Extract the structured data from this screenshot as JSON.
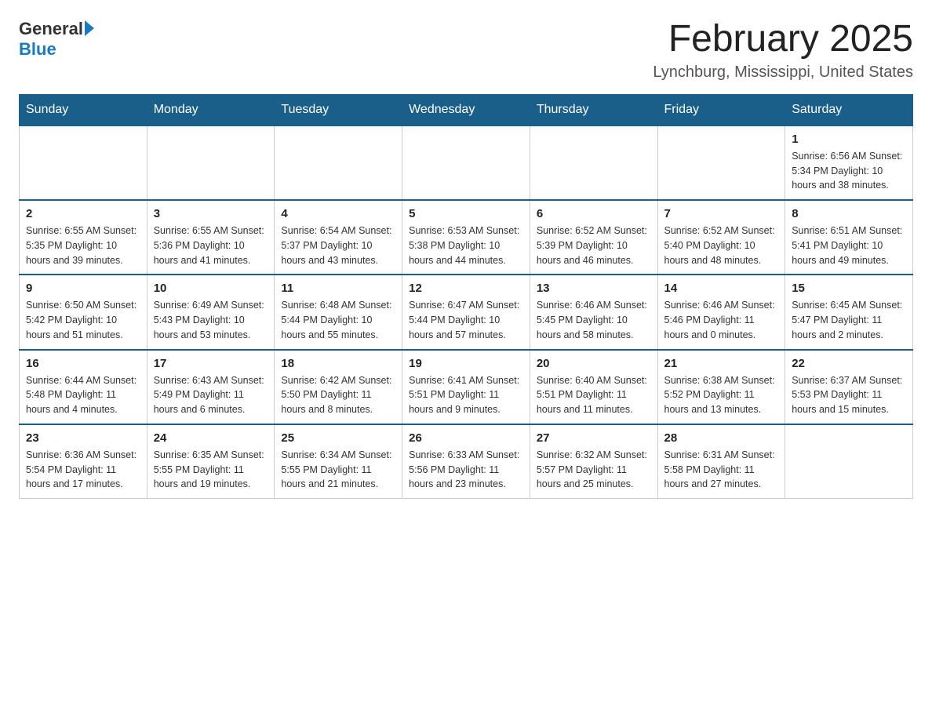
{
  "logo": {
    "general": "General",
    "blue": "Blue"
  },
  "title": "February 2025",
  "subtitle": "Lynchburg, Mississippi, United States",
  "weekdays": [
    "Sunday",
    "Monday",
    "Tuesday",
    "Wednesday",
    "Thursday",
    "Friday",
    "Saturday"
  ],
  "weeks": [
    [
      {
        "day": "",
        "info": ""
      },
      {
        "day": "",
        "info": ""
      },
      {
        "day": "",
        "info": ""
      },
      {
        "day": "",
        "info": ""
      },
      {
        "day": "",
        "info": ""
      },
      {
        "day": "",
        "info": ""
      },
      {
        "day": "1",
        "info": "Sunrise: 6:56 AM\nSunset: 5:34 PM\nDaylight: 10 hours and 38 minutes."
      }
    ],
    [
      {
        "day": "2",
        "info": "Sunrise: 6:55 AM\nSunset: 5:35 PM\nDaylight: 10 hours and 39 minutes."
      },
      {
        "day": "3",
        "info": "Sunrise: 6:55 AM\nSunset: 5:36 PM\nDaylight: 10 hours and 41 minutes."
      },
      {
        "day": "4",
        "info": "Sunrise: 6:54 AM\nSunset: 5:37 PM\nDaylight: 10 hours and 43 minutes."
      },
      {
        "day": "5",
        "info": "Sunrise: 6:53 AM\nSunset: 5:38 PM\nDaylight: 10 hours and 44 minutes."
      },
      {
        "day": "6",
        "info": "Sunrise: 6:52 AM\nSunset: 5:39 PM\nDaylight: 10 hours and 46 minutes."
      },
      {
        "day": "7",
        "info": "Sunrise: 6:52 AM\nSunset: 5:40 PM\nDaylight: 10 hours and 48 minutes."
      },
      {
        "day": "8",
        "info": "Sunrise: 6:51 AM\nSunset: 5:41 PM\nDaylight: 10 hours and 49 minutes."
      }
    ],
    [
      {
        "day": "9",
        "info": "Sunrise: 6:50 AM\nSunset: 5:42 PM\nDaylight: 10 hours and 51 minutes."
      },
      {
        "day": "10",
        "info": "Sunrise: 6:49 AM\nSunset: 5:43 PM\nDaylight: 10 hours and 53 minutes."
      },
      {
        "day": "11",
        "info": "Sunrise: 6:48 AM\nSunset: 5:44 PM\nDaylight: 10 hours and 55 minutes."
      },
      {
        "day": "12",
        "info": "Sunrise: 6:47 AM\nSunset: 5:44 PM\nDaylight: 10 hours and 57 minutes."
      },
      {
        "day": "13",
        "info": "Sunrise: 6:46 AM\nSunset: 5:45 PM\nDaylight: 10 hours and 58 minutes."
      },
      {
        "day": "14",
        "info": "Sunrise: 6:46 AM\nSunset: 5:46 PM\nDaylight: 11 hours and 0 minutes."
      },
      {
        "day": "15",
        "info": "Sunrise: 6:45 AM\nSunset: 5:47 PM\nDaylight: 11 hours and 2 minutes."
      }
    ],
    [
      {
        "day": "16",
        "info": "Sunrise: 6:44 AM\nSunset: 5:48 PM\nDaylight: 11 hours and 4 minutes."
      },
      {
        "day": "17",
        "info": "Sunrise: 6:43 AM\nSunset: 5:49 PM\nDaylight: 11 hours and 6 minutes."
      },
      {
        "day": "18",
        "info": "Sunrise: 6:42 AM\nSunset: 5:50 PM\nDaylight: 11 hours and 8 minutes."
      },
      {
        "day": "19",
        "info": "Sunrise: 6:41 AM\nSunset: 5:51 PM\nDaylight: 11 hours and 9 minutes."
      },
      {
        "day": "20",
        "info": "Sunrise: 6:40 AM\nSunset: 5:51 PM\nDaylight: 11 hours and 11 minutes."
      },
      {
        "day": "21",
        "info": "Sunrise: 6:38 AM\nSunset: 5:52 PM\nDaylight: 11 hours and 13 minutes."
      },
      {
        "day": "22",
        "info": "Sunrise: 6:37 AM\nSunset: 5:53 PM\nDaylight: 11 hours and 15 minutes."
      }
    ],
    [
      {
        "day": "23",
        "info": "Sunrise: 6:36 AM\nSunset: 5:54 PM\nDaylight: 11 hours and 17 minutes."
      },
      {
        "day": "24",
        "info": "Sunrise: 6:35 AM\nSunset: 5:55 PM\nDaylight: 11 hours and 19 minutes."
      },
      {
        "day": "25",
        "info": "Sunrise: 6:34 AM\nSunset: 5:55 PM\nDaylight: 11 hours and 21 minutes."
      },
      {
        "day": "26",
        "info": "Sunrise: 6:33 AM\nSunset: 5:56 PM\nDaylight: 11 hours and 23 minutes."
      },
      {
        "day": "27",
        "info": "Sunrise: 6:32 AM\nSunset: 5:57 PM\nDaylight: 11 hours and 25 minutes."
      },
      {
        "day": "28",
        "info": "Sunrise: 6:31 AM\nSunset: 5:58 PM\nDaylight: 11 hours and 27 minutes."
      },
      {
        "day": "",
        "info": ""
      }
    ]
  ]
}
